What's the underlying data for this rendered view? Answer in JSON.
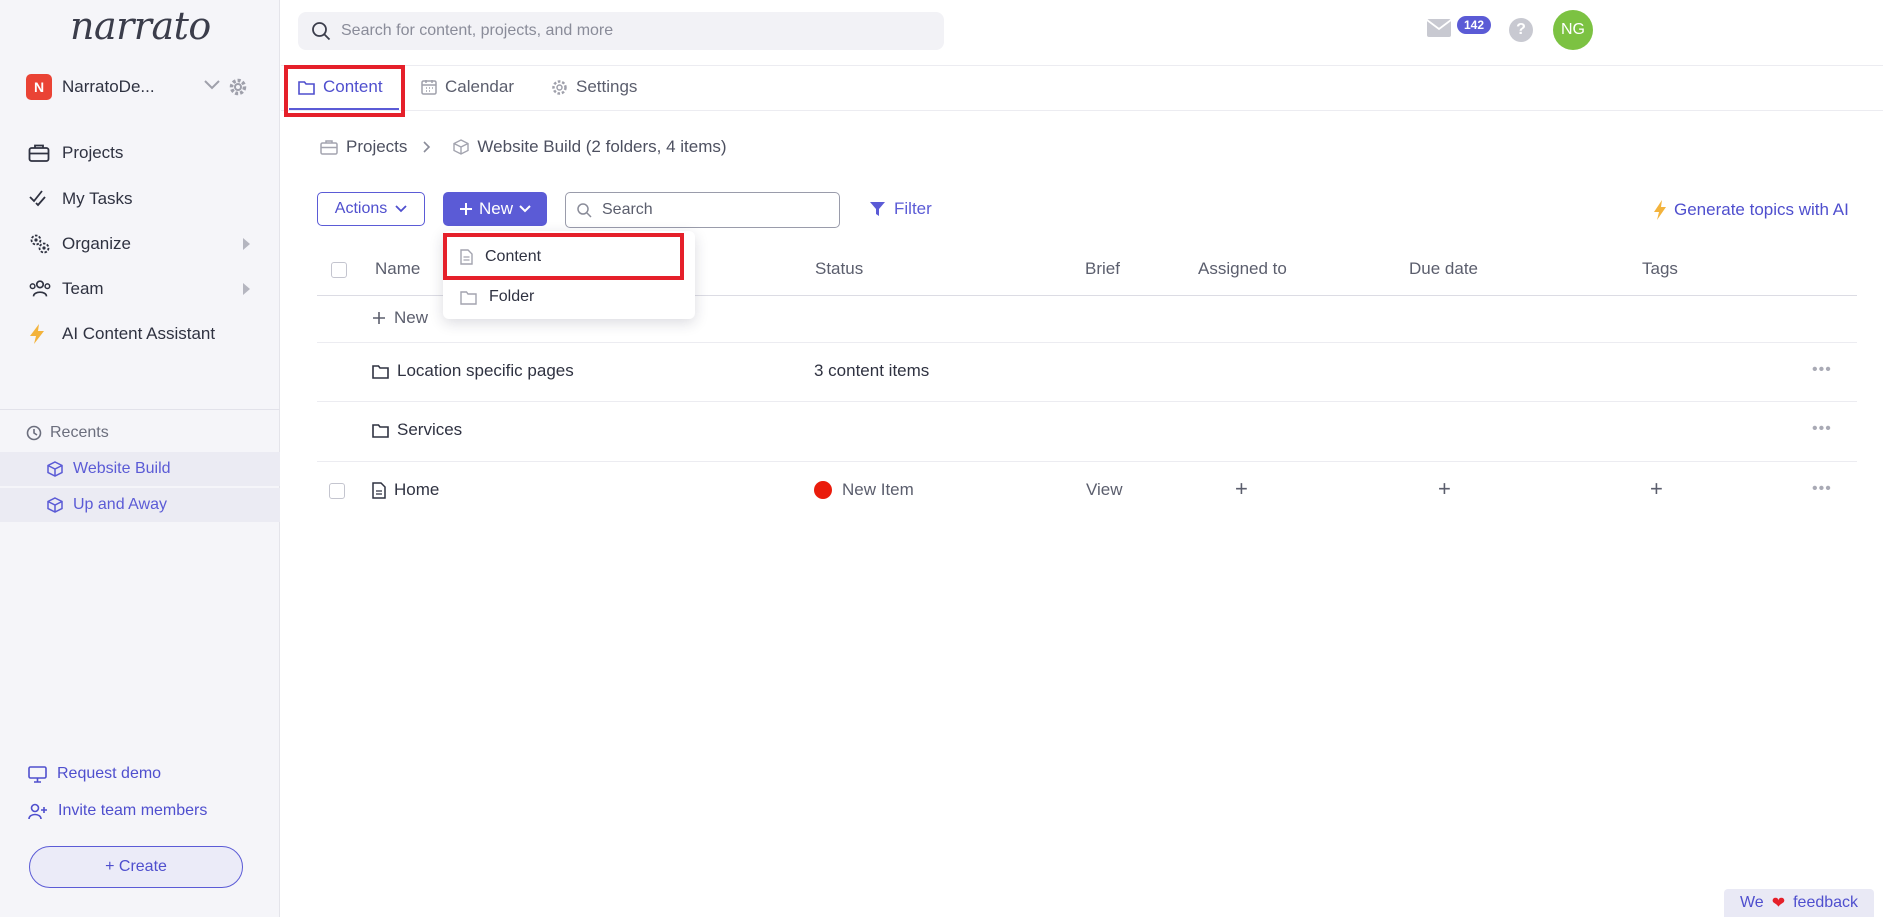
{
  "app": {
    "logo_text": "narrato"
  },
  "org": {
    "avatar_letter": "N",
    "name": "NarratoDe..."
  },
  "sidebar": {
    "items": [
      {
        "label": "Projects",
        "icon": "briefcase-icon"
      },
      {
        "label": "My Tasks",
        "icon": "checklist-icon"
      },
      {
        "label": "Organize",
        "icon": "gears-icon"
      },
      {
        "label": "Team",
        "icon": "team-icon"
      },
      {
        "label": "AI Content Assistant",
        "icon": "lightning-icon"
      }
    ],
    "recents_title": "Recents",
    "recents": [
      {
        "label": "Website Build",
        "icon": "cube-icon"
      },
      {
        "label": "Up and Away",
        "icon": "cube-icon"
      }
    ],
    "request_demo": "Request demo",
    "invite": "Invite team members",
    "create_label": "+ Create"
  },
  "topbar": {
    "search_placeholder": "Search for content, projects, and more",
    "mail_count": "142",
    "help_label": "?",
    "user_initials": "NG"
  },
  "tabs": [
    {
      "label": "Content",
      "icon": "folder-icon",
      "active": true
    },
    {
      "label": "Calendar",
      "icon": "calendar-icon",
      "active": false
    },
    {
      "label": "Settings",
      "icon": "gear-icon",
      "active": false
    }
  ],
  "breadcrumb": {
    "root": "Projects",
    "current": "Website Build (2 folders, 4 items)"
  },
  "toolbar": {
    "actions_label": "Actions",
    "new_label": "New",
    "search_placeholder": "Search",
    "filter_label": "Filter",
    "generate_label": "Generate topics with AI"
  },
  "new_menu": {
    "items": [
      {
        "label": "Content",
        "icon": "document-icon"
      },
      {
        "label": "Folder",
        "icon": "folder-icon"
      }
    ]
  },
  "table": {
    "columns": [
      "Name",
      "Status",
      "Brief",
      "Assigned to",
      "Due date",
      "Tags"
    ],
    "new_row_label": "New",
    "rows": [
      {
        "name": "Location specific pages",
        "type": "folder",
        "status": "3 content items"
      },
      {
        "name": "Services",
        "type": "folder",
        "status": ""
      },
      {
        "name": "Home",
        "type": "document",
        "status": "New Item",
        "status_color": "#ea1c0c",
        "brief": "View"
      }
    ]
  },
  "feedback": {
    "we": "We",
    "heart": "❤",
    "label": "feedback"
  },
  "colors": {
    "accent": "#5b5bd6",
    "highlight_box": "#e5202a",
    "avatar": "#7cc242"
  }
}
